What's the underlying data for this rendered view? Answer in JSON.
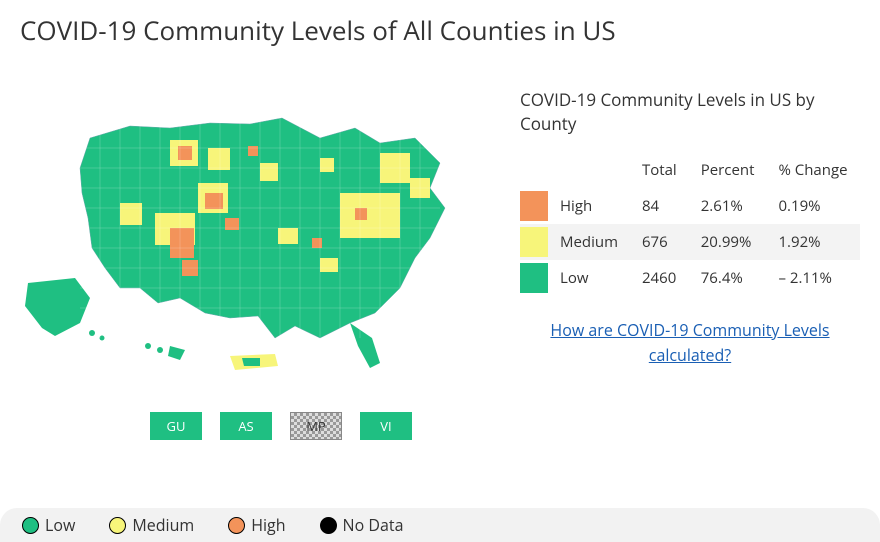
{
  "title": "COVID-19 Community Levels of All Counties in US",
  "side": {
    "title": "COVID-19 Community Levels in US by County",
    "headers": {
      "total": "Total",
      "percent": "Percent",
      "change": "% Change"
    },
    "rows": {
      "high": {
        "label": "High",
        "total": "84",
        "percent": "2.61%",
        "change": "0.19%"
      },
      "medium": {
        "label": "Medium",
        "total": "676",
        "percent": "20.99%",
        "change": "1.92%"
      },
      "low": {
        "label": "Low",
        "total": "2460",
        "percent": "76.4%",
        "change": "– 2.11%"
      }
    },
    "link": "How are COVID-19 Community Levels calculated?"
  },
  "territories": {
    "gu": "GU",
    "as": "AS",
    "mp": "MP",
    "vi": "VI"
  },
  "legend": {
    "low": "Low",
    "medium": "Medium",
    "high": "High",
    "nodata": "No Data"
  },
  "colors": {
    "low": "#1fbf82",
    "medium": "#f7f57a",
    "high": "#f3935a",
    "nodata": "#000000"
  }
}
